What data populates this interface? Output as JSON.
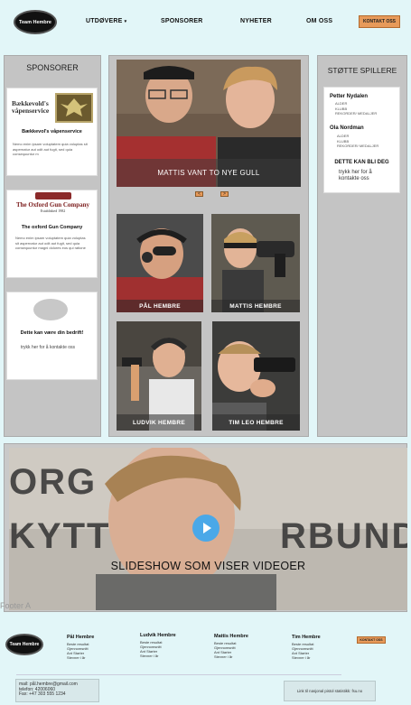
{
  "header": {
    "logo_text": "Team Hembre",
    "nav": [
      "UTDØVERE",
      "SPONSORER",
      "NYHETER",
      "OM OSS"
    ],
    "nav_dropdown_symbol": "▾",
    "contact_button": "KONTAKT OSS"
  },
  "sponsors": {
    "title": "SPONSORER",
    "cards": [
      {
        "logo_text_line1": "Bækkevold's",
        "logo_text_line2": "våpenservice",
        "name": "Bækkevol's våpenservice",
        "description": "Nemo enim ipsam voluptatem quia voluptas sit aspernatur aut odit aut fugit, sed quia consequuntur m"
      },
      {
        "logo_text_line1": "The Oxford Gun Company",
        "logo_text_line2": "Established 1982",
        "name": "The oxford Gun Company",
        "description": "Nemo enim ipsam voluptatem quia voluptas sit aspernatur aut odit aut fugit, sed quia consequuntur magni dolores eos qui ratione"
      },
      {
        "name": "Dette kan være din bedrift!",
        "cta": "trykk her for å kontakte oss"
      }
    ]
  },
  "hero": {
    "caption": "MATTIS VANT TO NYE GULL",
    "prev": "<",
    "next": ">"
  },
  "athletes": [
    {
      "name": "PÅL HEMBRE"
    },
    {
      "name": "MATTIS HEMBRE"
    },
    {
      "name": "LUDVIK HEMBRE"
    },
    {
      "name": "TIM LEO HEMBRE"
    }
  ],
  "support": {
    "title": "STØTTE SPILLERE",
    "players": [
      {
        "name": "Petter Nydalen",
        "items": [
          "ALDER",
          "KLUBB",
          "REKORDER/ MEDALJER"
        ]
      },
      {
        "name": "Ola Nordman",
        "items": [
          "ALDER",
          "KLUBB",
          "REKORDER/ MEDALJER"
        ]
      }
    ],
    "cta_title": "DETTE KAN BLI DEG",
    "cta_text": "trykk her for å kontakte oss"
  },
  "video": {
    "caption": "SLIDESHOW SOM VISER VIDEOER",
    "bg_text_line1": "ORG",
    "bg_text_line2": "KYTT",
    "bg_text_line3": "RBUND"
  },
  "footer": {
    "label": "Footer A",
    "logo_text": "Team Hembre",
    "columns": [
      {
        "name": "Pål Hembre",
        "items": [
          "Beste resultat",
          "Gjennomsnitt",
          "Ant Starter",
          "Stevner i år"
        ]
      },
      {
        "name": "Ludvik Hembre",
        "items": [
          "Beste resultat",
          "Gjennomsnitt",
          "Ant Starter",
          "Stevner i år"
        ]
      },
      {
        "name": "Mattis Hembre",
        "items": [
          "Beste resultat",
          "Gjennomsnitt",
          "Ant Starter",
          "Stevner i år"
        ]
      },
      {
        "name": "Tim Hembre",
        "items": [
          "Beste resultat",
          "Gjennomsnitt",
          "Ant Starter",
          "Stevner i år"
        ]
      }
    ],
    "contact_button": "KONTAKT OSS",
    "contact_lines": [
      "mail: pål.hembre@gmail.com",
      "telefon: 42006060",
      "Fax: +47 303 555 1234"
    ],
    "link_text": "Link til nasjonal pistol statistikk: fsu.no"
  },
  "colors": {
    "accent": "#e79a5a",
    "page_bg": "#e2f6f8",
    "panel": "#c4c4c4"
  }
}
